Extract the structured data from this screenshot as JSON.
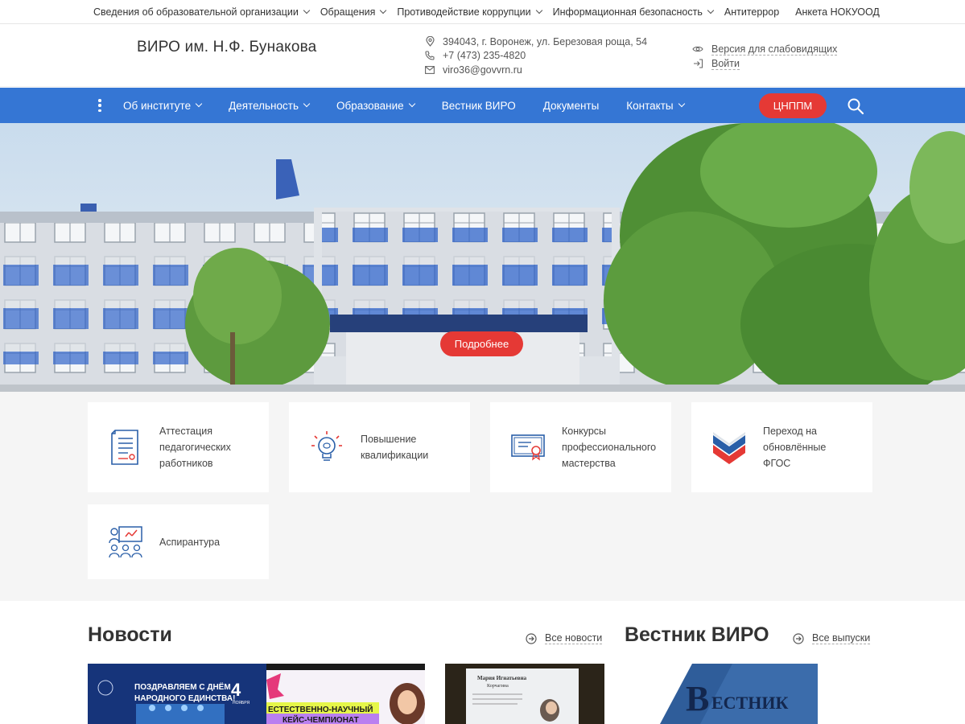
{
  "topbar": {
    "items": [
      {
        "label": "Сведения об образовательной организации",
        "dropdown": true
      },
      {
        "label": "Обращения",
        "dropdown": true
      },
      {
        "label": "Противодействие коррупции",
        "dropdown": true
      },
      {
        "label": "Информационная безопасность",
        "dropdown": true
      },
      {
        "label": "Антитеррор",
        "dropdown": false
      },
      {
        "label": "Анкета НОКУООД",
        "dropdown": false
      }
    ]
  },
  "header": {
    "title": "ВИРО им. Н.Ф. Бунакова",
    "address": "394043, г. Воронеж, ул. Березовая роща, 54",
    "phone": "+7 (473) 235-4820",
    "email": "viro36@govvrn.ru",
    "accessibility_label": "Версия для слабовидящих",
    "login_label": "Войти"
  },
  "nav": {
    "items": [
      {
        "label": "Об институте",
        "dropdown": true
      },
      {
        "label": "Деятельность",
        "dropdown": true
      },
      {
        "label": "Образование",
        "dropdown": true
      },
      {
        "label": "Вестник ВИРО",
        "dropdown": false
      },
      {
        "label": "Документы",
        "dropdown": false
      },
      {
        "label": "Контакты",
        "dropdown": true
      }
    ],
    "cta_label": "ЦНППМ"
  },
  "hero": {
    "button_label": "Подробнее"
  },
  "services": [
    {
      "line1": "Аттестация",
      "line2": "педагогических",
      "line3": "работников",
      "icon": "document-icon"
    },
    {
      "line1": "Повышение",
      "line2": "квалификации",
      "line3": "",
      "icon": "lightbulb-icon"
    },
    {
      "line1": "Конкурсы",
      "line2": "профессионального",
      "line3": "мастерства",
      "icon": "certificate-icon"
    },
    {
      "line1": "Переход на",
      "line2": "обновлённые",
      "line3": "ФГОС",
      "icon": "fgos-logo-icon"
    },
    {
      "line1": "Аспирантура",
      "line2": "",
      "line3": "",
      "icon": "classroom-icon"
    }
  ],
  "news": {
    "title": "Новости",
    "all_label": "Все новости",
    "items": [
      {
        "caption_line1": "ПОЗДРАВЛЯЕМ С ДНЁМ",
        "caption_line2": "НАРОДНОГО ЕДИНСТВА!",
        "day": "4",
        "month": "НОЯБРЯ"
      },
      {
        "caption_line1": "ЕСТЕСТВЕННО-НАУЧНЫЙ",
        "caption_line2": "КЕЙС-ЧЕМПИОНАТ"
      },
      {
        "caption_line1": "Мария Игнатьевна",
        "caption_line2": "Корчагина"
      }
    ]
  },
  "vestnik": {
    "title": "Вестник ВИРО",
    "all_label": "Все выпуски",
    "cover_big": "В",
    "cover_rest": "ЕСТНИК"
  },
  "colors": {
    "nav_blue": "#3576d4",
    "accent_red": "#e53935",
    "icon_blue": "#2a5fa8"
  }
}
